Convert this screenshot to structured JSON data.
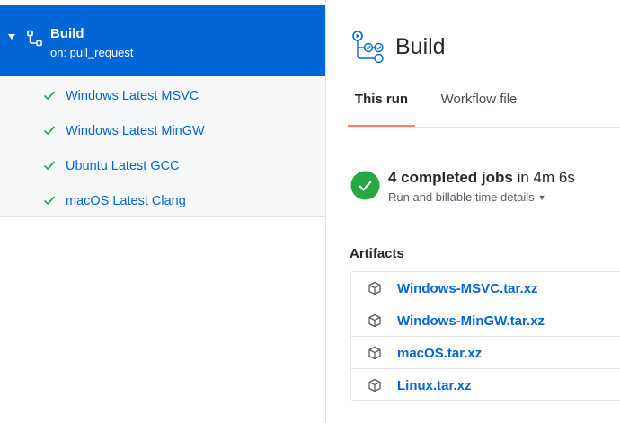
{
  "sidebar": {
    "workflow": {
      "title": "Build",
      "trigger": "on: pull_request"
    },
    "jobs": [
      {
        "label": "Windows Latest MSVC",
        "status": "success"
      },
      {
        "label": "Windows Latest MinGW",
        "status": "success"
      },
      {
        "label": "Ubuntu Latest GCC",
        "status": "success"
      },
      {
        "label": "macOS Latest Clang",
        "status": "success"
      }
    ]
  },
  "main": {
    "title": "Build",
    "tabs": [
      {
        "label": "This run",
        "active": true
      },
      {
        "label": "Workflow file",
        "active": false
      }
    ],
    "summary": {
      "jobs_text": "4 completed jobs",
      "duration_text": " in 4m 6s",
      "billable_text": "Run and billable time details"
    },
    "artifacts": {
      "title": "Artifacts",
      "items": [
        {
          "name": "Windows-MSVC.tar.xz"
        },
        {
          "name": "Windows-MinGW.tar.xz"
        },
        {
          "name": "macOS.tar.xz"
        },
        {
          "name": "Linux.tar.xz"
        }
      ]
    }
  },
  "colors": {
    "accent": "#0366d6",
    "success": "#28a745",
    "tab_underline": "#f9826c"
  }
}
